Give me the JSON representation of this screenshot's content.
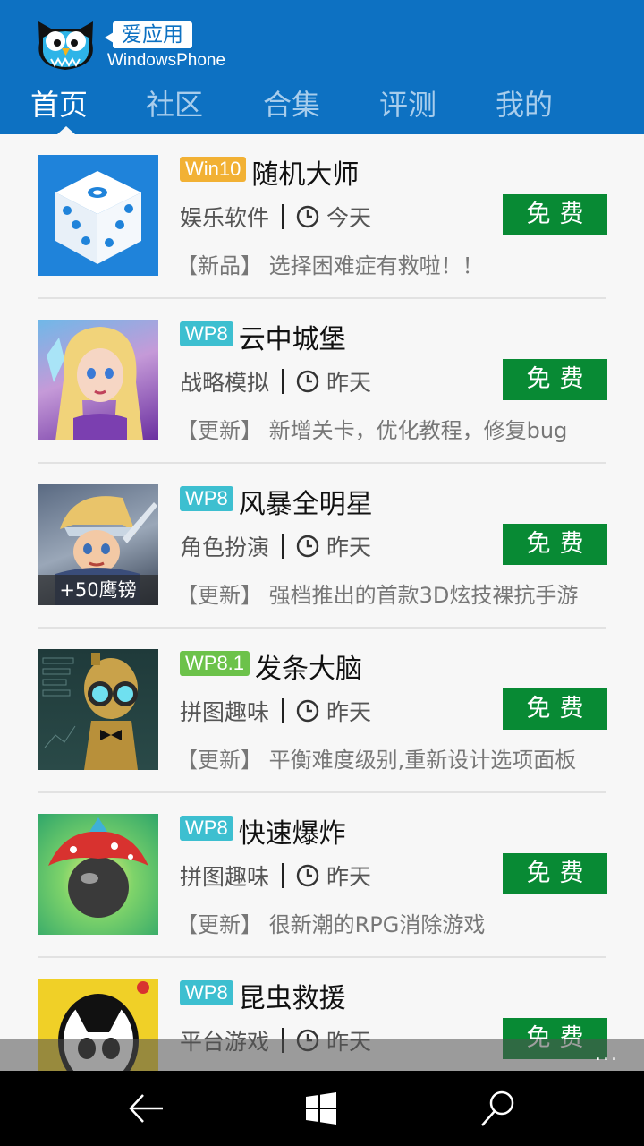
{
  "header": {
    "bubble": "爱应用",
    "subtitle": "WindowsPhone",
    "tabs": [
      {
        "label": "首页",
        "active": true
      },
      {
        "label": "社区",
        "active": false
      },
      {
        "label": "合集",
        "active": false
      },
      {
        "label": "评测",
        "active": false
      },
      {
        "label": "我的",
        "active": false
      }
    ]
  },
  "apps": [
    {
      "badge": "Win10",
      "badge_color": "#f2b134",
      "title": "随机大师",
      "category": "娱乐软件",
      "date": "今天",
      "desc": "【新品】 选择困难症有救啦！！",
      "button": "免费",
      "icon": "dice-icon"
    },
    {
      "badge": "WP8",
      "badge_color": "#3dbfd0",
      "title": "云中城堡",
      "category": "战略模拟",
      "date": "昨天",
      "desc": "【更新】 新增关卡，优化教程，修复bug",
      "button": "免费",
      "icon": "princess-icon"
    },
    {
      "badge": "WP8",
      "badge_color": "#3dbfd0",
      "title": "风暴全明星",
      "category": "角色扮演",
      "date": "昨天",
      "desc": "【更新】 强档推出的首款3D炫技裸抗手游",
      "button": "免费",
      "icon": "warrior-icon",
      "overlay": "+50鹰镑"
    },
    {
      "badge": "WP8.1",
      "badge_color": "#6cc24a",
      "title": "发条大脑",
      "category": "拼图趣味",
      "date": "昨天",
      "desc": "【更新】 平衡难度级别,重新设计选项面板",
      "button": "免费",
      "icon": "robot-icon"
    },
    {
      "badge": "WP8",
      "badge_color": "#3dbfd0",
      "title": "快速爆炸",
      "category": "拼图趣味",
      "date": "昨天",
      "desc": "【更新】 很新潮的RPG消除游戏",
      "button": "免费",
      "icon": "bomb-icon"
    },
    {
      "badge": "WP8",
      "badge_color": "#3dbfd0",
      "title": "昆虫救援",
      "category": "平台游戏",
      "date": "昨天",
      "desc": "",
      "button": "免费",
      "icon": "bug-icon"
    }
  ],
  "appbar": {
    "more": "..."
  }
}
